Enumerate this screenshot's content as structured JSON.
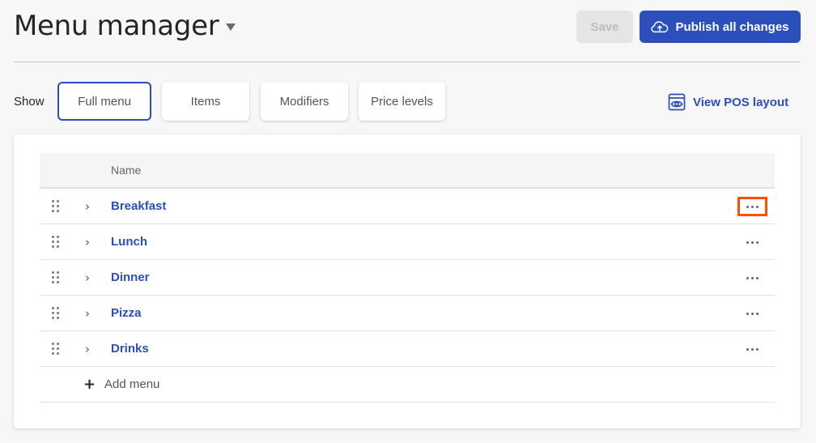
{
  "header": {
    "title": "Menu manager",
    "save_label": "Save",
    "publish_label": "Publish all changes",
    "publish_icon": "cloud-upload-icon",
    "accent_color": "#2b4fbb"
  },
  "filters": {
    "label": "Show",
    "options": [
      {
        "label": "Full menu",
        "active": true
      },
      {
        "label": "Items",
        "active": false
      },
      {
        "label": "Modifiers",
        "active": false
      },
      {
        "label": "Price levels",
        "active": false
      }
    ],
    "view_pos_label": "View POS layout",
    "view_pos_icon": "eye-window-icon"
  },
  "table": {
    "columns": [
      "Name"
    ],
    "rows": [
      {
        "name": "Breakfast",
        "highlighted_actions": true
      },
      {
        "name": "Lunch",
        "highlighted_actions": false
      },
      {
        "name": "Dinner",
        "highlighted_actions": false
      },
      {
        "name": "Pizza",
        "highlighted_actions": false
      },
      {
        "name": "Drinks",
        "highlighted_actions": false
      }
    ],
    "add_label": "Add menu",
    "highlight_color": "#ff4f00"
  }
}
